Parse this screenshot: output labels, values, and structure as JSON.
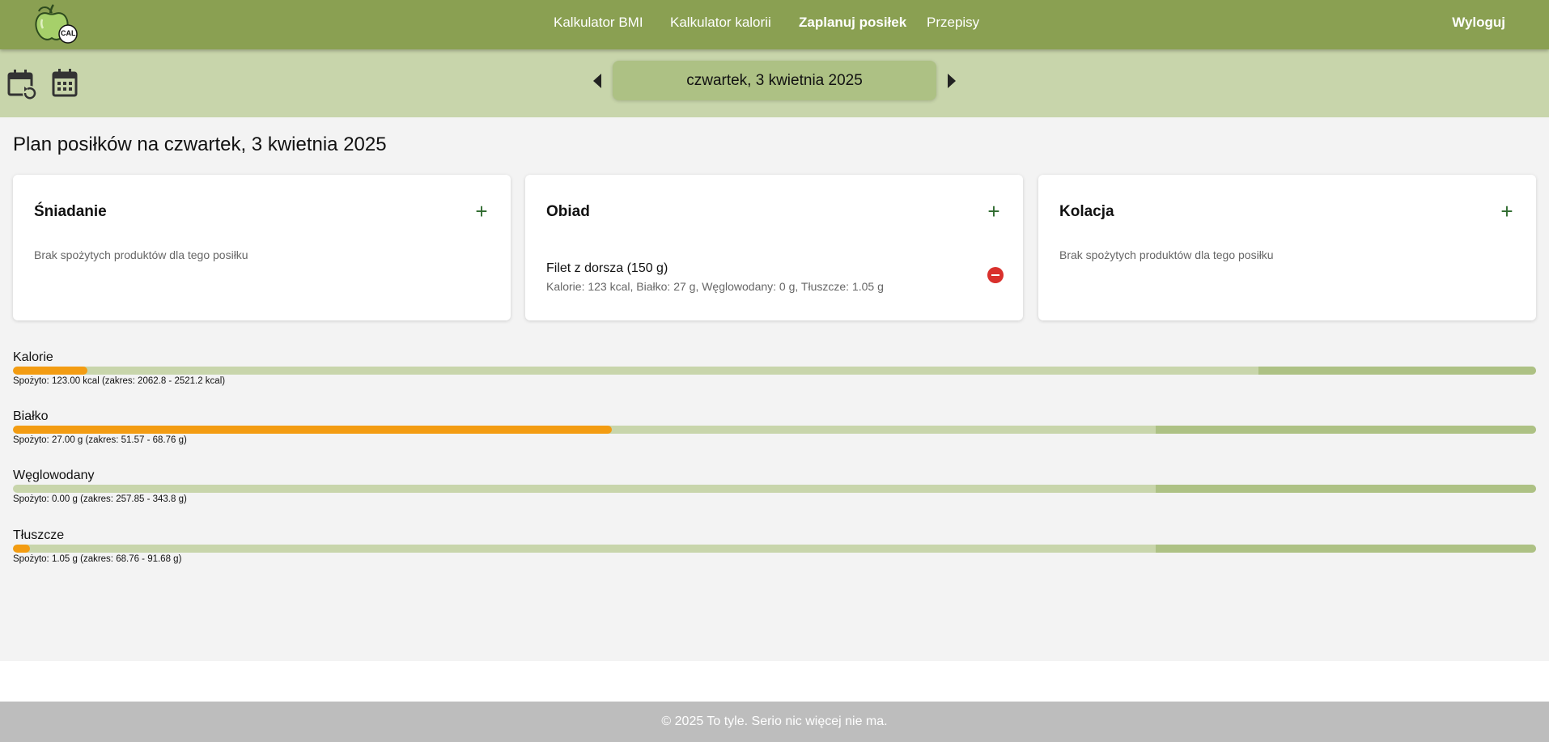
{
  "nav": {
    "logo_text": "CAL",
    "links": [
      {
        "label": "Kalkulator BMI"
      },
      {
        "label": "Kalkulator kalorii"
      },
      {
        "label": "Zaplanuj posiłek"
      },
      {
        "label": "Przepisy"
      }
    ],
    "active_link": "Zaplanuj posiłek",
    "logout_label": "Wyloguj"
  },
  "datebar": {
    "current_date": "czwartek, 3 kwietnia 2025",
    "icons": [
      "calendar-reset-icon",
      "calendar-icon",
      "previous-day-icon",
      "next-day-icon"
    ]
  },
  "page": {
    "title": "Plan posiłków na czwartek, 3 kwietnia 2025"
  },
  "meals": [
    {
      "title": "Śniadanie",
      "add_label": "+",
      "empty_message": "Brak spożytych produktów dla tego posiłku",
      "items": []
    },
    {
      "title": "Obiad",
      "add_label": "+",
      "empty_message": "",
      "items": [
        {
          "name": "Filet z dorsza (150 g)",
          "info": "Kalorie: 123 kcal, Białko: 27 g, Węglowodany: 0 g, Tłuszcze: 1.05 g"
        }
      ]
    },
    {
      "title": "Kolacja",
      "add_label": "+",
      "empty_message": "Brak spożytych produktów dla tego posiłku",
      "items": []
    }
  ],
  "nutrients": [
    {
      "label": "Kalorie",
      "summary": "Spożyto: 123.00 kcal (zakres: 2062.8 - 2521.2 kcal)",
      "consumed_fraction": 0.049,
      "range_start_fraction": 0.818
    },
    {
      "label": "Białko",
      "summary": "Spożyto: 27.00 g (zakres: 51.57 - 68.76 g)",
      "consumed_fraction": 0.393,
      "range_start_fraction": 0.75
    },
    {
      "label": "Węglowodany",
      "summary": "Spożyto: 0.00 g (zakres: 257.85 - 343.8 g)",
      "consumed_fraction": 0.0,
      "range_start_fraction": 0.75
    },
    {
      "label": "Tłuszcze",
      "summary": "Spożyto: 1.05 g (zakres: 68.76 - 91.68 g)",
      "consumed_fraction": 0.011,
      "range_start_fraction": 0.75
    }
  ],
  "colors": {
    "nav_bg": "#8aa052",
    "datebar_bg": "#c8d5ab",
    "bar_track": "#c8d5ab",
    "bar_range": "#adc184",
    "bar_fill": "#f39c12",
    "remove": "#d9302c"
  },
  "footer": {
    "text": "© 2025 To tyle. Serio nic więcej nie ma."
  }
}
